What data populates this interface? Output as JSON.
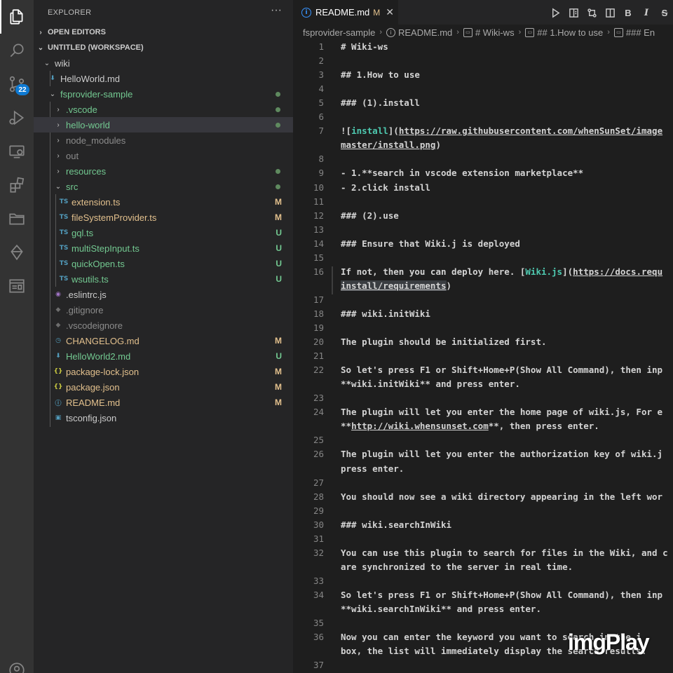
{
  "activity_bar": {
    "icons": [
      "explorer-icon",
      "search-icon",
      "source-control-icon",
      "run-debug-icon",
      "remote-explorer-icon",
      "extensions-icon",
      "folder-icon",
      "timeline-icon",
      "wiki-icon",
      "account-icon"
    ],
    "scm_badge": "22"
  },
  "explorer": {
    "title": "EXPLORER",
    "more": "···",
    "open_editors": "OPEN EDITORS",
    "workspace": "UNTITLED (WORKSPACE)",
    "items": [
      {
        "label": "wiki",
        "status": "",
        "kind": "folder-open"
      },
      {
        "label": "HelloWorld.md",
        "status": "",
        "kind": "md-down"
      },
      {
        "label": "fsprovider-sample",
        "status": "dot",
        "kind": "folder-open"
      },
      {
        "label": ".vscode",
        "status": "dot",
        "kind": "folder"
      },
      {
        "label": "hello-world",
        "status": "dot",
        "kind": "folder"
      },
      {
        "label": "node_modules",
        "status": "",
        "kind": "folder"
      },
      {
        "label": "out",
        "status": "",
        "kind": "folder"
      },
      {
        "label": "resources",
        "status": "dot",
        "kind": "folder"
      },
      {
        "label": "src",
        "status": "dot",
        "kind": "folder-open"
      },
      {
        "label": "extension.ts",
        "status": "M",
        "kind": "ts"
      },
      {
        "label": "fileSystemProvider.ts",
        "status": "M",
        "kind": "ts"
      },
      {
        "label": "gql.ts",
        "status": "U",
        "kind": "ts"
      },
      {
        "label": "multiStepInput.ts",
        "status": "U",
        "kind": "ts"
      },
      {
        "label": "quickOpen.ts",
        "status": "U",
        "kind": "ts"
      },
      {
        "label": "wsutils.ts",
        "status": "U",
        "kind": "ts"
      },
      {
        "label": ".eslintrc.js",
        "status": "",
        "kind": "eslint"
      },
      {
        "label": ".gitignore",
        "status": "",
        "kind": "git"
      },
      {
        "label": ".vscodeignore",
        "status": "",
        "kind": "git"
      },
      {
        "label": "CHANGELOG.md",
        "status": "M",
        "kind": "clock"
      },
      {
        "label": "HelloWorld2.md",
        "status": "U",
        "kind": "md-down"
      },
      {
        "label": "package-lock.json",
        "status": "M",
        "kind": "json"
      },
      {
        "label": "package.json",
        "status": "M",
        "kind": "json"
      },
      {
        "label": "README.md",
        "status": "M",
        "kind": "info"
      },
      {
        "label": "tsconfig.json",
        "status": "",
        "kind": "tsconfig"
      }
    ]
  },
  "editor": {
    "tab": {
      "label": "README.md",
      "modified": "M",
      "close": "✕"
    },
    "toolbar": [
      "▷",
      "⊟",
      "⇆",
      "◫",
      "B",
      "I",
      "S"
    ],
    "breadcrumb": [
      "fsprovider-sample",
      "README.md",
      "# Wiki-ws",
      "## 1.How to use",
      "### En"
    ],
    "lines": [
      {
        "n": "1",
        "text": "# Wiki-ws"
      },
      {
        "n": "2",
        "text": ""
      },
      {
        "n": "3",
        "text": "## 1.How to use"
      },
      {
        "n": "4",
        "text": ""
      },
      {
        "n": "5",
        "text": "### (1).install"
      },
      {
        "n": "6",
        "text": ""
      },
      {
        "n": "7",
        "text": "![install](https://raw.githubusercontent.com/whenSunSet/image"
      },
      {
        "n": "",
        "text": "master/install.png)"
      },
      {
        "n": "8",
        "text": ""
      },
      {
        "n": "9",
        "text": "- 1.**search in vscode extension marketplace**"
      },
      {
        "n": "10",
        "text": "- 2.click install"
      },
      {
        "n": "11",
        "text": ""
      },
      {
        "n": "12",
        "text": "### (2).use"
      },
      {
        "n": "13",
        "text": ""
      },
      {
        "n": "14",
        "text": "### Ensure that Wiki.j is deployed"
      },
      {
        "n": "15",
        "text": ""
      },
      {
        "n": "16",
        "text": "If not, then you can deploy here. [Wiki.js](https://docs.requ"
      },
      {
        "n": "",
        "text": "install/requirements)"
      },
      {
        "n": "17",
        "text": ""
      },
      {
        "n": "18",
        "text": "### wiki.initWiki"
      },
      {
        "n": "19",
        "text": ""
      },
      {
        "n": "20",
        "text": "The plugin should be initialized first."
      },
      {
        "n": "21",
        "text": ""
      },
      {
        "n": "22",
        "text": "So let's press F1 or Shift+Home+P(Show All Command), then inp"
      },
      {
        "n": "",
        "text": "**wiki.initWiki** and press enter."
      },
      {
        "n": "23",
        "text": ""
      },
      {
        "n": "24",
        "text": "The plugin will let you enter the home page of wiki.js, For e"
      },
      {
        "n": "",
        "text": "**http://wiki.whensunset.com**, then press enter."
      },
      {
        "n": "25",
        "text": ""
      },
      {
        "n": "26",
        "text": "The plugin will let you enter the authorization key of wiki.j"
      },
      {
        "n": "",
        "text": "press enter."
      },
      {
        "n": "27",
        "text": ""
      },
      {
        "n": "28",
        "text": "You should now see a wiki directory appearing in the left wor"
      },
      {
        "n": "29",
        "text": ""
      },
      {
        "n": "30",
        "text": "### wiki.searchInWiki"
      },
      {
        "n": "31",
        "text": ""
      },
      {
        "n": "32",
        "text": "You can use this plugin to search for files in the Wiki, and c"
      },
      {
        "n": "",
        "text": "are synchronized to the server in real time."
      },
      {
        "n": "33",
        "text": ""
      },
      {
        "n": "34",
        "text": "So let's press F1 or Shift+Home+P(Show All Command), then inp"
      },
      {
        "n": "",
        "text": "**wiki.searchInWiki** and press enter."
      },
      {
        "n": "35",
        "text": ""
      },
      {
        "n": "36",
        "text": "Now you can enter the keyword you want to search in the i"
      },
      {
        "n": "",
        "text": "box, the list will immediately display the search results."
      },
      {
        "n": "37",
        "text": ""
      }
    ]
  },
  "watermark": "imgPlay",
  "colors": {
    "accent": "#0e7ad3",
    "modified": "#e2c08d",
    "untracked": "#73c991",
    "link": "#4ec9b0"
  }
}
